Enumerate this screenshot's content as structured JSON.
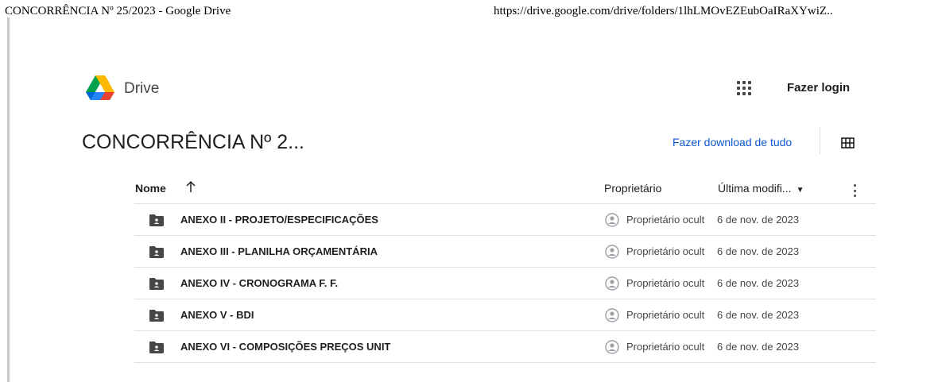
{
  "print": {
    "title": "CONCORRÊNCIA Nº 25/2023 - Google Drive",
    "url": "https://drive.google.com/drive/folders/1lhLMOvEZEubOaIRaXYwiZ.."
  },
  "header": {
    "app_name": "Drive",
    "login_label": "Fazer login",
    "icons": [
      "drive-logo",
      "apps-grid-icon"
    ]
  },
  "folder": {
    "title": "CONCORRÊNCIA Nº 2...",
    "download_all_label": "Fazer download de tudo"
  },
  "columns": {
    "name": "Nome",
    "owner": "Proprietário",
    "modified": "Última modifi..."
  },
  "files": [
    {
      "name": "ANEXO II - PROJETO/ESPECIFICAÇÕES",
      "owner": "Proprietário ocult",
      "modified": "6 de nov. de 2023"
    },
    {
      "name": "ANEXO III - PLANILHA ORÇAMENTÁRIA",
      "owner": "Proprietário ocult",
      "modified": "6 de nov. de 2023"
    },
    {
      "name": "ANEXO IV - CRONOGRAMA F. F.",
      "owner": "Proprietário ocult",
      "modified": "6 de nov. de 2023"
    },
    {
      "name": "ANEXO V - BDI",
      "owner": "Proprietário ocult",
      "modified": "6 de nov. de 2023"
    },
    {
      "name": "ANEXO VI - COMPOSIÇÕES PREÇOS UNIT",
      "owner": "Proprietário ocult",
      "modified": "6 de nov. de 2023"
    }
  ],
  "colors": {
    "link": "#0b57d0",
    "icon": "#444746",
    "divider": "#e0e0e0"
  }
}
